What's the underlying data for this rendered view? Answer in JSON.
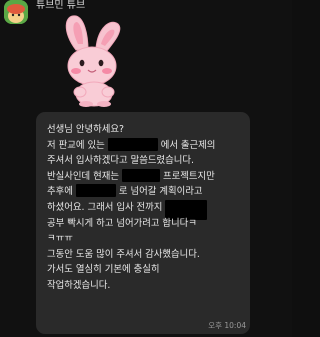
{
  "chat": {
    "sender_name": "튜브민 튜브",
    "timestamp": "오후 10:04",
    "message": {
      "line1": "선생님 안녕하세요?",
      "line2_a": "저 판교에 있는",
      "line2_b": "에서 출근제의",
      "line3": "주셔서 입사하겠다고 말씀드렸습니다.",
      "line4_a": "반실사인데 현재는",
      "line4_b": "프로젝트지만",
      "line5_a": "추후에",
      "line5_b": "로 넘어갈 계획이라고",
      "line6": "하셨어요. 그래서 입사 전까지",
      "line7": "공부 빡시게 하고 넘어가려고 합니다ㅋ",
      "line8": "ㅋㅠㅠ",
      "line9": "그동안 도움 많이 주셔서 감사했습니다.",
      "line10": "가서도 열심히 기본에 충실히",
      "line11": "작업하겠습니다."
    }
  },
  "icons": {
    "avatar": "profile-avatar-icon",
    "sticker": "pink-bunny-sticker"
  },
  "colors": {
    "background": "#111111",
    "bubble": "#2a2a2a",
    "text": "#e8e8e8",
    "redaction": "#000000",
    "sticker_pink": "#f7b6c6"
  }
}
